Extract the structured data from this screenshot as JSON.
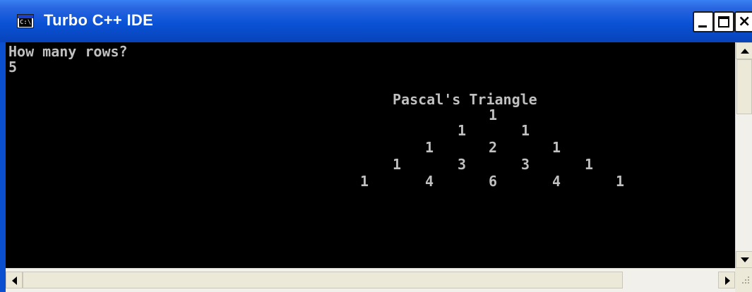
{
  "window": {
    "title": "Turbo C++ IDE",
    "icon_label": "C:\\",
    "controls": {
      "minimize": "minimize-icon",
      "maximize": "maximize-icon",
      "close": "close-icon",
      "close_glyph": "×"
    }
  },
  "console": {
    "prompt": "How many rows?",
    "input_value": "5",
    "heading": "Pascal's Triangle",
    "rows": [
      [
        "1"
      ],
      [
        "1",
        "1"
      ],
      [
        "1",
        "2",
        "1"
      ],
      [
        "1",
        "3",
        "3",
        "1"
      ],
      [
        "1",
        "4",
        "6",
        "4",
        "1"
      ]
    ],
    "colors": {
      "background": "#000000",
      "text": "#c0c0c0"
    }
  },
  "scrollbars": {
    "vertical": {
      "up": "arrow-up-icon",
      "down": "arrow-down-icon"
    },
    "horizontal": {
      "left": "arrow-left-icon",
      "right": "arrow-right-icon"
    }
  },
  "theme": {
    "titlebar_color": "#0a52d6",
    "titlebar_text_color": "#ffffff"
  }
}
